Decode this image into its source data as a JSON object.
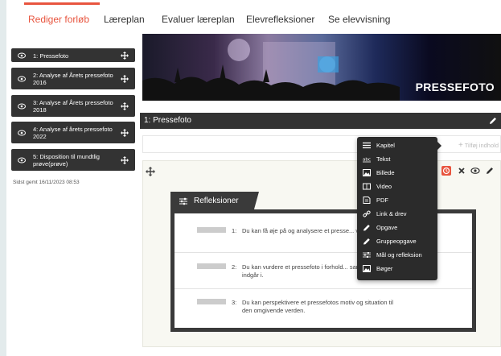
{
  "tabs": [
    {
      "label": "Rediger forløb",
      "active": true
    },
    {
      "label": "Læreplan",
      "active": false
    },
    {
      "label": "Evaluer læreplan",
      "active": false
    },
    {
      "label": "Elevrefleksioner",
      "active": false
    },
    {
      "label": "Se elevvisning",
      "active": false
    }
  ],
  "sidebar": {
    "items": [
      {
        "label": "1: Pressefoto"
      },
      {
        "label": "2: Analyse af Årets pressefoto 2016"
      },
      {
        "label": "3: Analyse af Årets pressefoto 2018"
      },
      {
        "label": "4: Analyse af årets pressefoto 2022"
      },
      {
        "label": "5: Disposition til mundtlig prøve(prøve)"
      }
    ],
    "saved": "Sidst gemt 16/11/2023 08:53"
  },
  "banner": {
    "title": "PRESSEFOTO"
  },
  "chapter": {
    "title": "1:  Pressefoto"
  },
  "add_content": {
    "label": "Tilføj indhold"
  },
  "reflections": {
    "title": "Refleksioner",
    "items": [
      {
        "num": "1:",
        "text": "Du kan få øje på og analysere et presse... virkemidler."
      },
      {
        "num": "2:",
        "text": "Du kan vurdere et pressefoto i forhold... sammenhæng, det indgår i."
      },
      {
        "num": "3:",
        "text": "Du kan perspektivere et pressefotos motiv og situation til den omgivende verden."
      }
    ]
  },
  "menu": {
    "items": [
      {
        "label": "Kapitel",
        "icon": "menu-lines-icon"
      },
      {
        "label": "Tekst",
        "icon": "text-abc-icon"
      },
      {
        "label": "Billede",
        "icon": "image-icon"
      },
      {
        "label": "Video",
        "icon": "video-icon"
      },
      {
        "label": "PDF",
        "icon": "pdf-icon"
      },
      {
        "label": "Link & drev",
        "icon": "link-icon"
      },
      {
        "label": "Opgave",
        "icon": "pencil-icon"
      },
      {
        "label": "Gruppeopgave",
        "icon": "pencil-icon"
      },
      {
        "label": "Mål og refleksion",
        "icon": "sliders-icon"
      },
      {
        "label": "Bøger",
        "icon": "book-icon"
      }
    ]
  },
  "colors": {
    "accent": "#e8553f",
    "dark": "#333333",
    "background": "#e3ebec"
  }
}
